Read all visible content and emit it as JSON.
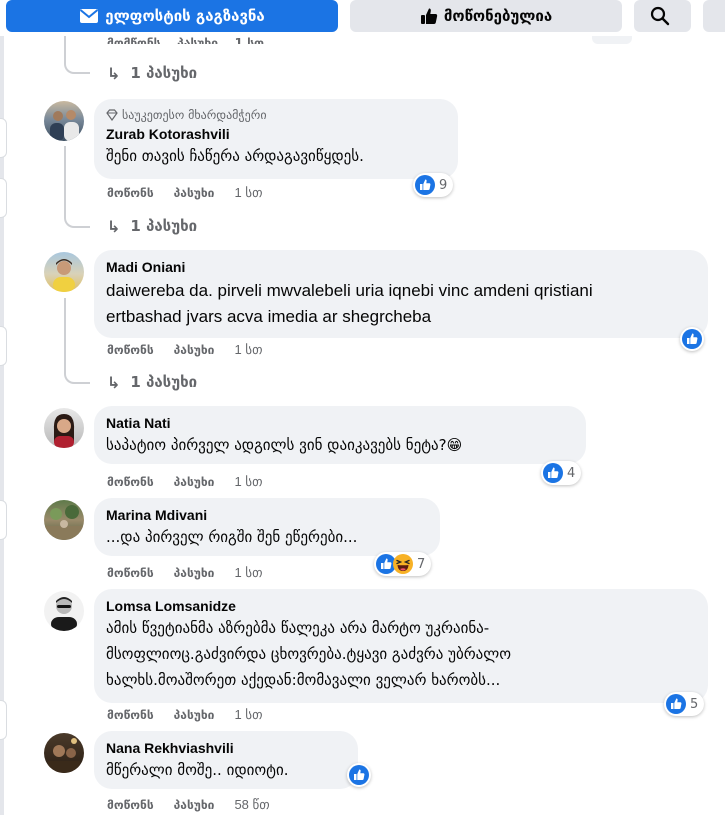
{
  "topbar": {
    "email_button": "ელფოსტის გაგზავნა",
    "like_button": "მოწონებულია"
  },
  "labels": {
    "like_action": "მოწონს",
    "reply_action": "პასუხი",
    "view_replies": "1 პასუხი"
  },
  "colors": {
    "primary": "#1b74e4",
    "bubble": "#f0f2f5",
    "secondary_text": "#65676b"
  },
  "comments": [
    {
      "badge": "საუკეთესო მხარდამჭერი",
      "author": "Zurab Kotorashvili",
      "lines": [
        "შენი თავის ჩაწერა არდაგავიწყდეს."
      ],
      "reactions": [
        "like"
      ],
      "reaction_count": "9",
      "time": "1 სთ",
      "replies": "1 პასუხი"
    },
    {
      "author": "Madi Oniani",
      "lines": [
        "daiwereba da. pirveli mwvalebeli uria iqnebi vinc amdeni qristiani",
        "ertbashad jvars acva imedia ar shegrcheba"
      ],
      "reactions": [
        "like"
      ],
      "time": "1 სთ",
      "replies": "1 პასუხი"
    },
    {
      "author": "Natia Nati",
      "lines": [
        "საპატიო პირველ ადგილს ვინ დაიკავებს ნეტა?"
      ],
      "emoji": "😁",
      "reactions": [
        "like"
      ],
      "reaction_count": "4",
      "time": "1 სთ"
    },
    {
      "author": "Marina Mdivani",
      "lines": [
        "...და პირველ რიგში შენ ეწერები..."
      ],
      "reactions": [
        "like",
        "haha"
      ],
      "reaction_count": "7",
      "time": "1 სთ"
    },
    {
      "author": "Lomsa Lomsanidze",
      "lines": [
        "ამის წვეტიანმა აზრებმა წალეკა არა მარტო უკრაინა-",
        "მსოფლიოც.გაძვირდა ცხოვრება.ტყავი გაძვრა უბრალო",
        "ხალხს.მოაშორეთ აქედან:მომავალი ველარ ხარობს..."
      ],
      "reactions": [
        "like"
      ],
      "reaction_count": "5",
      "time": "1 სთ"
    },
    {
      "author": "Nana Rekhviashvili",
      "lines": [
        "მწერალი მოშე.. იდიოტი."
      ],
      "reactions": [
        "like"
      ],
      "time": "58 წთ"
    }
  ]
}
